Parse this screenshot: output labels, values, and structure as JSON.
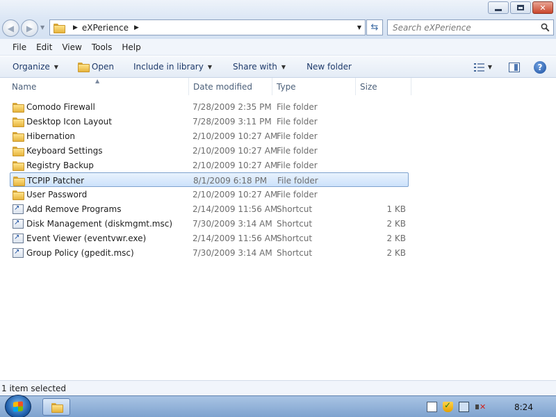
{
  "address": {
    "breadcrumb": "eXPerience"
  },
  "search": {
    "placeholder": "Search eXPerience"
  },
  "menu": {
    "file": "File",
    "edit": "Edit",
    "view": "View",
    "tools": "Tools",
    "help": "Help"
  },
  "toolbar": {
    "organize": "Organize",
    "open": "Open",
    "include_in_library": "Include in library",
    "share_with": "Share with",
    "new_folder": "New folder"
  },
  "columns": {
    "name": "Name",
    "date_modified": "Date modified",
    "type": "Type",
    "size": "Size"
  },
  "files": [
    {
      "name": "Comodo Firewall",
      "date": "7/28/2009 2:35 PM",
      "type": "File folder",
      "size": "",
      "icon": "folder-icon",
      "selected": false
    },
    {
      "name": "Desktop Icon Layout",
      "date": "7/28/2009 3:11 PM",
      "type": "File folder",
      "size": "",
      "icon": "folder-icon",
      "selected": false
    },
    {
      "name": "Hibernation",
      "date": "2/10/2009 10:27 AM",
      "type": "File folder",
      "size": "",
      "icon": "folder-icon",
      "selected": false
    },
    {
      "name": "Keyboard Settings",
      "date": "2/10/2009 10:27 AM",
      "type": "File folder",
      "size": "",
      "icon": "folder-icon",
      "selected": false
    },
    {
      "name": "Registry Backup",
      "date": "2/10/2009 10:27 AM",
      "type": "File folder",
      "size": "",
      "icon": "folder-icon",
      "selected": false
    },
    {
      "name": "TCPIP Patcher",
      "date": "8/1/2009 6:18 PM",
      "type": "File folder",
      "size": "",
      "icon": "folder-icon",
      "selected": true
    },
    {
      "name": "User Password",
      "date": "2/10/2009 10:27 AM",
      "type": "File folder",
      "size": "",
      "icon": "folder-icon",
      "selected": false
    },
    {
      "name": "Add Remove Programs",
      "date": "2/14/2009 11:56 AM",
      "type": "Shortcut",
      "size": "1 KB",
      "icon": "shortcut-icon",
      "selected": false
    },
    {
      "name": "Disk Management (diskmgmt.msc)",
      "date": "7/30/2009 3:14 AM",
      "type": "Shortcut",
      "size": "2 KB",
      "icon": "shortcut-icon",
      "selected": false
    },
    {
      "name": "Event Viewer (eventvwr.exe)",
      "date": "2/14/2009 11:56 AM",
      "type": "Shortcut",
      "size": "2 KB",
      "icon": "shortcut-icon",
      "selected": false
    },
    {
      "name": "Group Policy (gpedit.msc)",
      "date": "7/30/2009 3:14 AM",
      "type": "Shortcut",
      "size": "2 KB",
      "icon": "shortcut-icon",
      "selected": false
    }
  ],
  "status": {
    "text": "1 item selected"
  },
  "taskbar": {
    "clock": "8:24"
  },
  "colors": {
    "selection_border": "#7da2ce",
    "selection_fill": "#cde2fb",
    "link_text": "#1e3a6a",
    "secondary_text": "#6d6d6d"
  }
}
